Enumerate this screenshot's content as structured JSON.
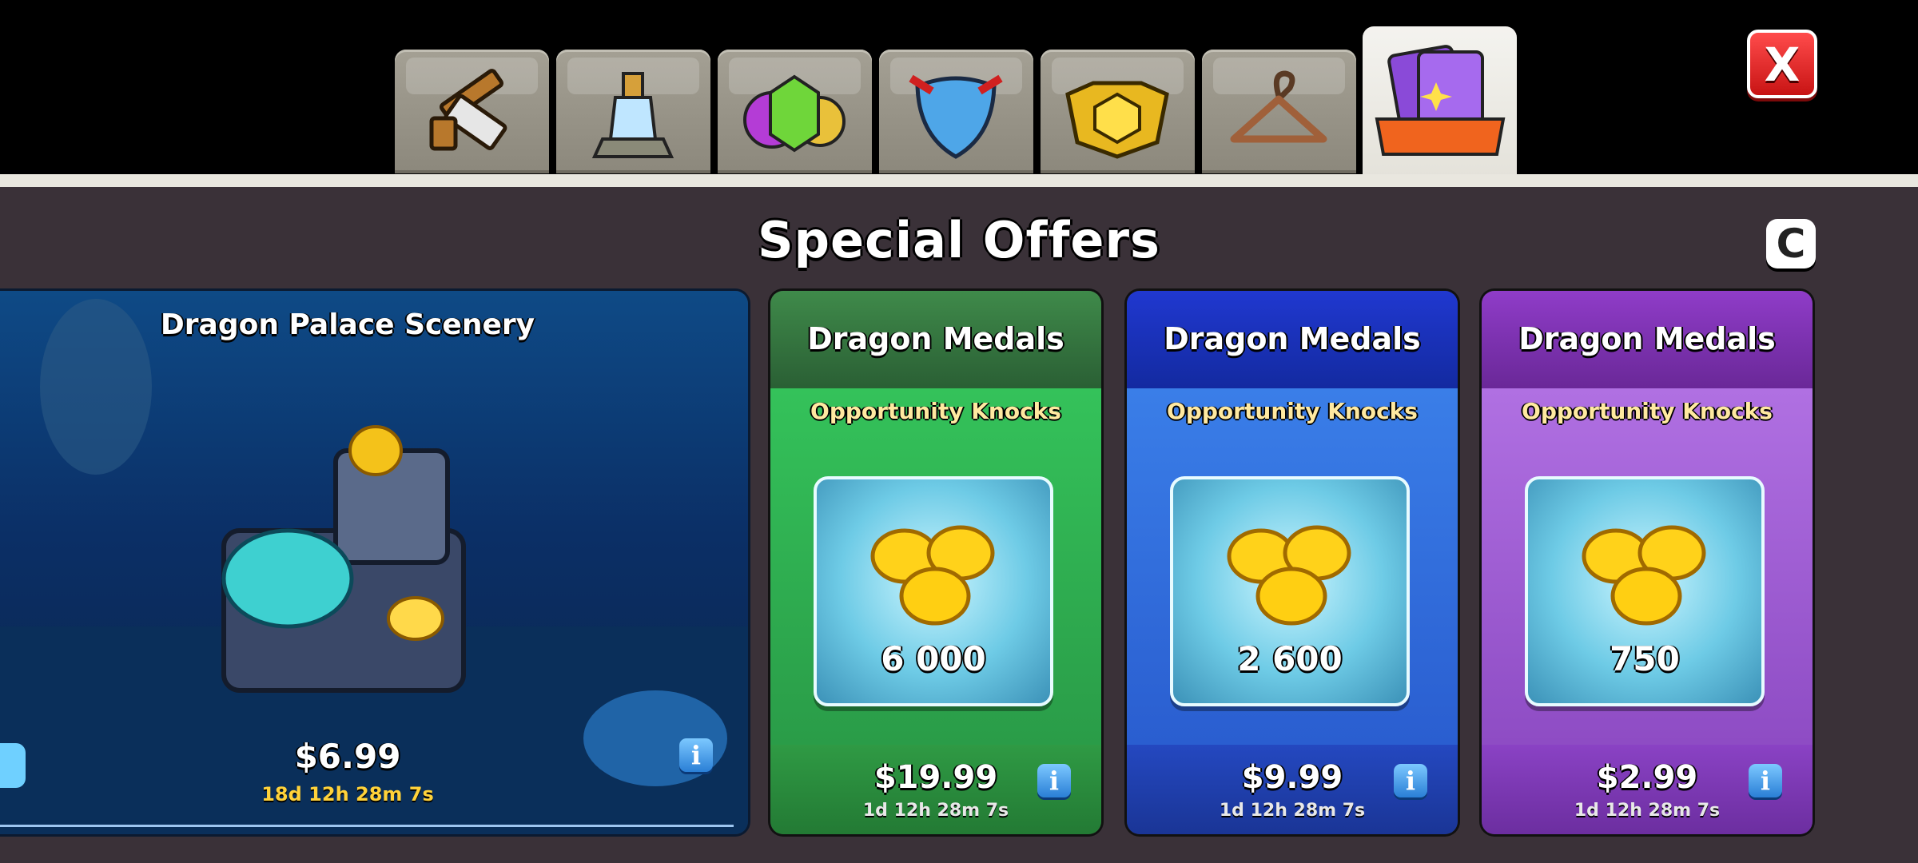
{
  "tabs": [
    {
      "name": "builder-tools-tab",
      "icon": "hammer-saw-icon"
    },
    {
      "name": "magic-items-tab",
      "icon": "potion-icon"
    },
    {
      "name": "gems-tab",
      "icon": "gems-coins-icon"
    },
    {
      "name": "defense-tab",
      "icon": "shield-arrows-icon"
    },
    {
      "name": "gold-pass-tab",
      "icon": "gold-badge-icon"
    },
    {
      "name": "cosmetics-tab",
      "icon": "hanger-icon"
    },
    {
      "name": "special-offers-tab",
      "icon": "cards-offer-icon",
      "active": true
    }
  ],
  "close_label": "X",
  "page_title": "Special Offers",
  "refresh_label": "C",
  "scenery_offer": {
    "title": "Dragon Palace Scenery",
    "price": "$6.99",
    "timer": "18d 12h 28m 7s",
    "info_label": "i"
  },
  "medal_offers": [
    {
      "title": "Dragon Medals",
      "subtitle": "Opportunity Knocks",
      "amount": "6 000",
      "price": "$19.99",
      "timer": "1d 12h 28m 7s",
      "info_label": "i",
      "theme": "green"
    },
    {
      "title": "Dragon Medals",
      "subtitle": "Opportunity Knocks",
      "amount": "2 600",
      "price": "$9.99",
      "timer": "1d 12h 28m 7s",
      "info_label": "i",
      "theme": "blue"
    },
    {
      "title": "Dragon Medals",
      "subtitle": "Opportunity Knocks",
      "amount": "750",
      "price": "$2.99",
      "timer": "1d 12h 28m 7s",
      "info_label": "i",
      "theme": "purple"
    }
  ],
  "colors": {
    "green_head": "#2f6b3a",
    "green_body": "#2fb34d",
    "green_foot": "#2a8a3c",
    "blue_head": "#1230b8",
    "blue_body": "#2f6fe0",
    "blue_foot": "#1d3fb0",
    "purple_head": "#7a2fb0",
    "purple_body": "#a05ad8",
    "purple_foot": "#7c35b5"
  }
}
